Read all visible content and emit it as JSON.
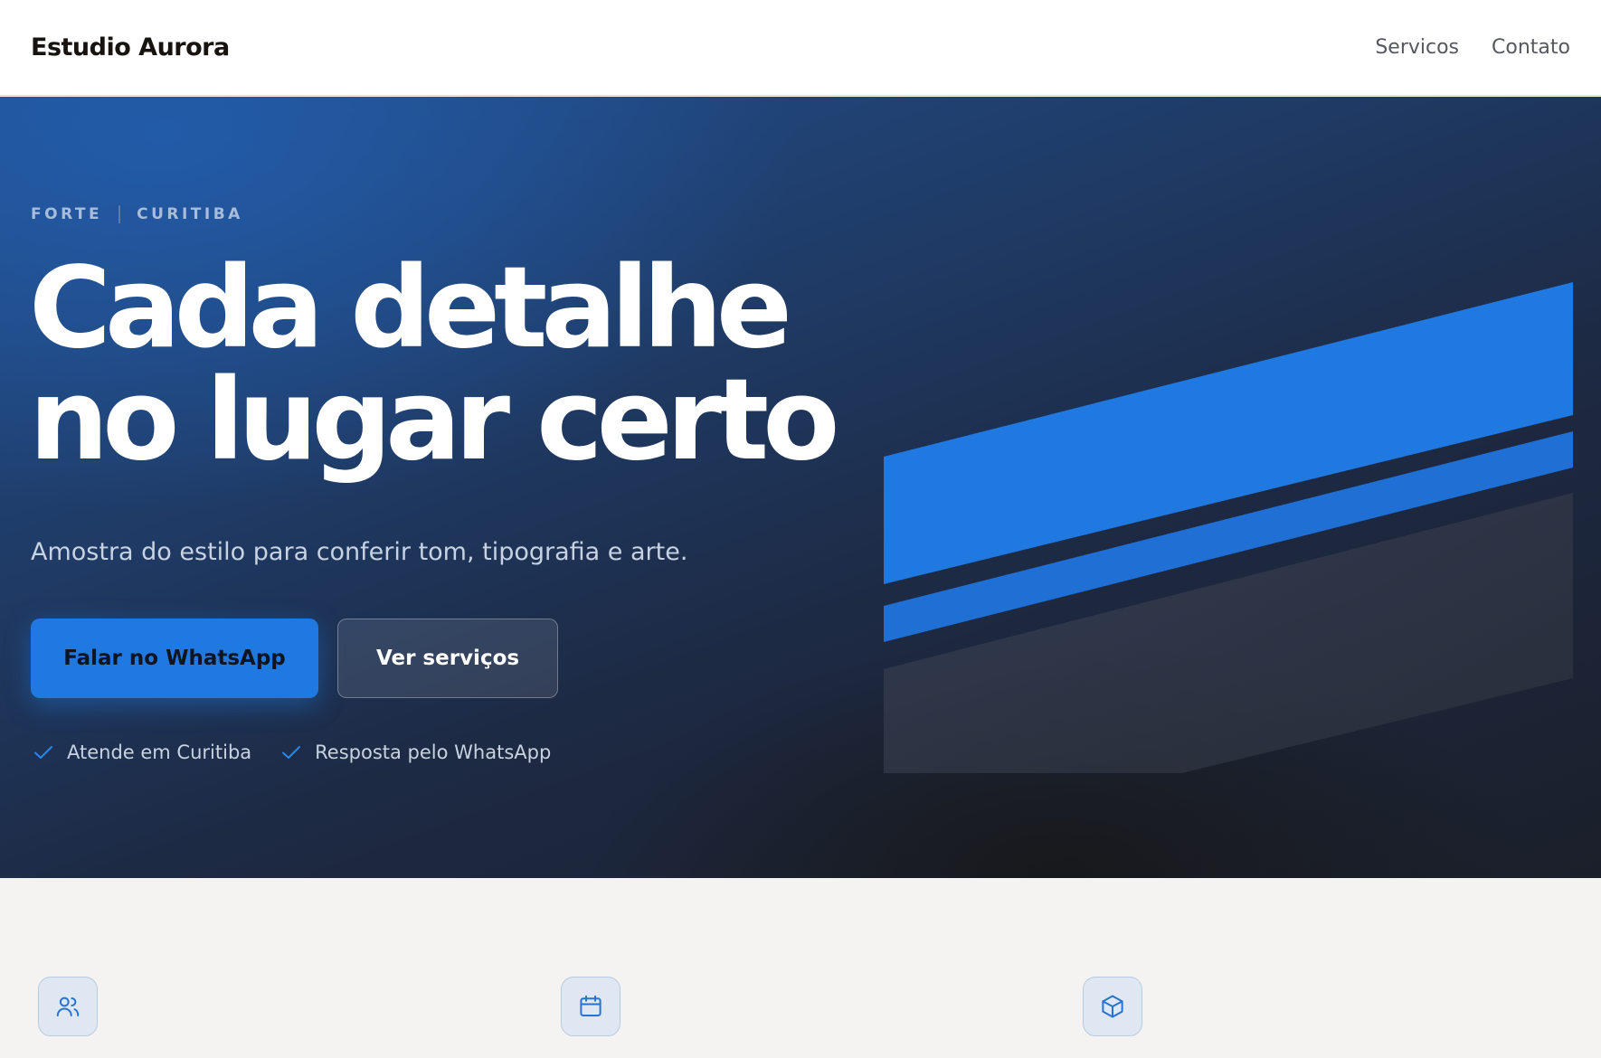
{
  "header": {
    "brand": "Estudio Aurora",
    "nav": [
      "Servicos",
      "Contato"
    ]
  },
  "hero": {
    "eyebrow": [
      "FORTE",
      "CURITIBA"
    ],
    "headline_line1": "Cada detalhe",
    "headline_line2": "no lugar certo",
    "subtitle": "Amostra do estilo para conferir tom, tipografia e arte.",
    "primary_button": "Falar no WhatsApp",
    "secondary_button": "Ver serviços",
    "checks": [
      "Atende em Curitiba",
      "Resposta pelo WhatsApp"
    ]
  },
  "features": {
    "icons": [
      "users-icon",
      "calendar-icon",
      "box-icon"
    ]
  },
  "colors": {
    "accent": "#1f79e0",
    "hero_dark": "#1b1f2a",
    "section_bg": "#f4f3f1"
  }
}
